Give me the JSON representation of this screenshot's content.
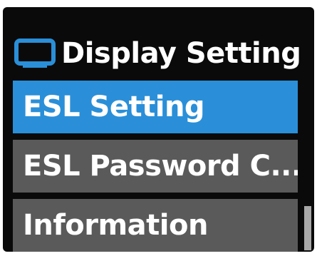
{
  "header": {
    "icon": "monitor-icon",
    "title": "Display Setting"
  },
  "menu": {
    "items": [
      {
        "label": "ESL Setting",
        "selected": true
      },
      {
        "label": "ESL Password C...",
        "selected": false
      },
      {
        "label": "Information",
        "selected": false
      }
    ]
  },
  "colors": {
    "selected": "#2a8fd8",
    "normal": "#5a5a5a",
    "background": "#0a0a0a",
    "icon": "#2a8fd8"
  }
}
